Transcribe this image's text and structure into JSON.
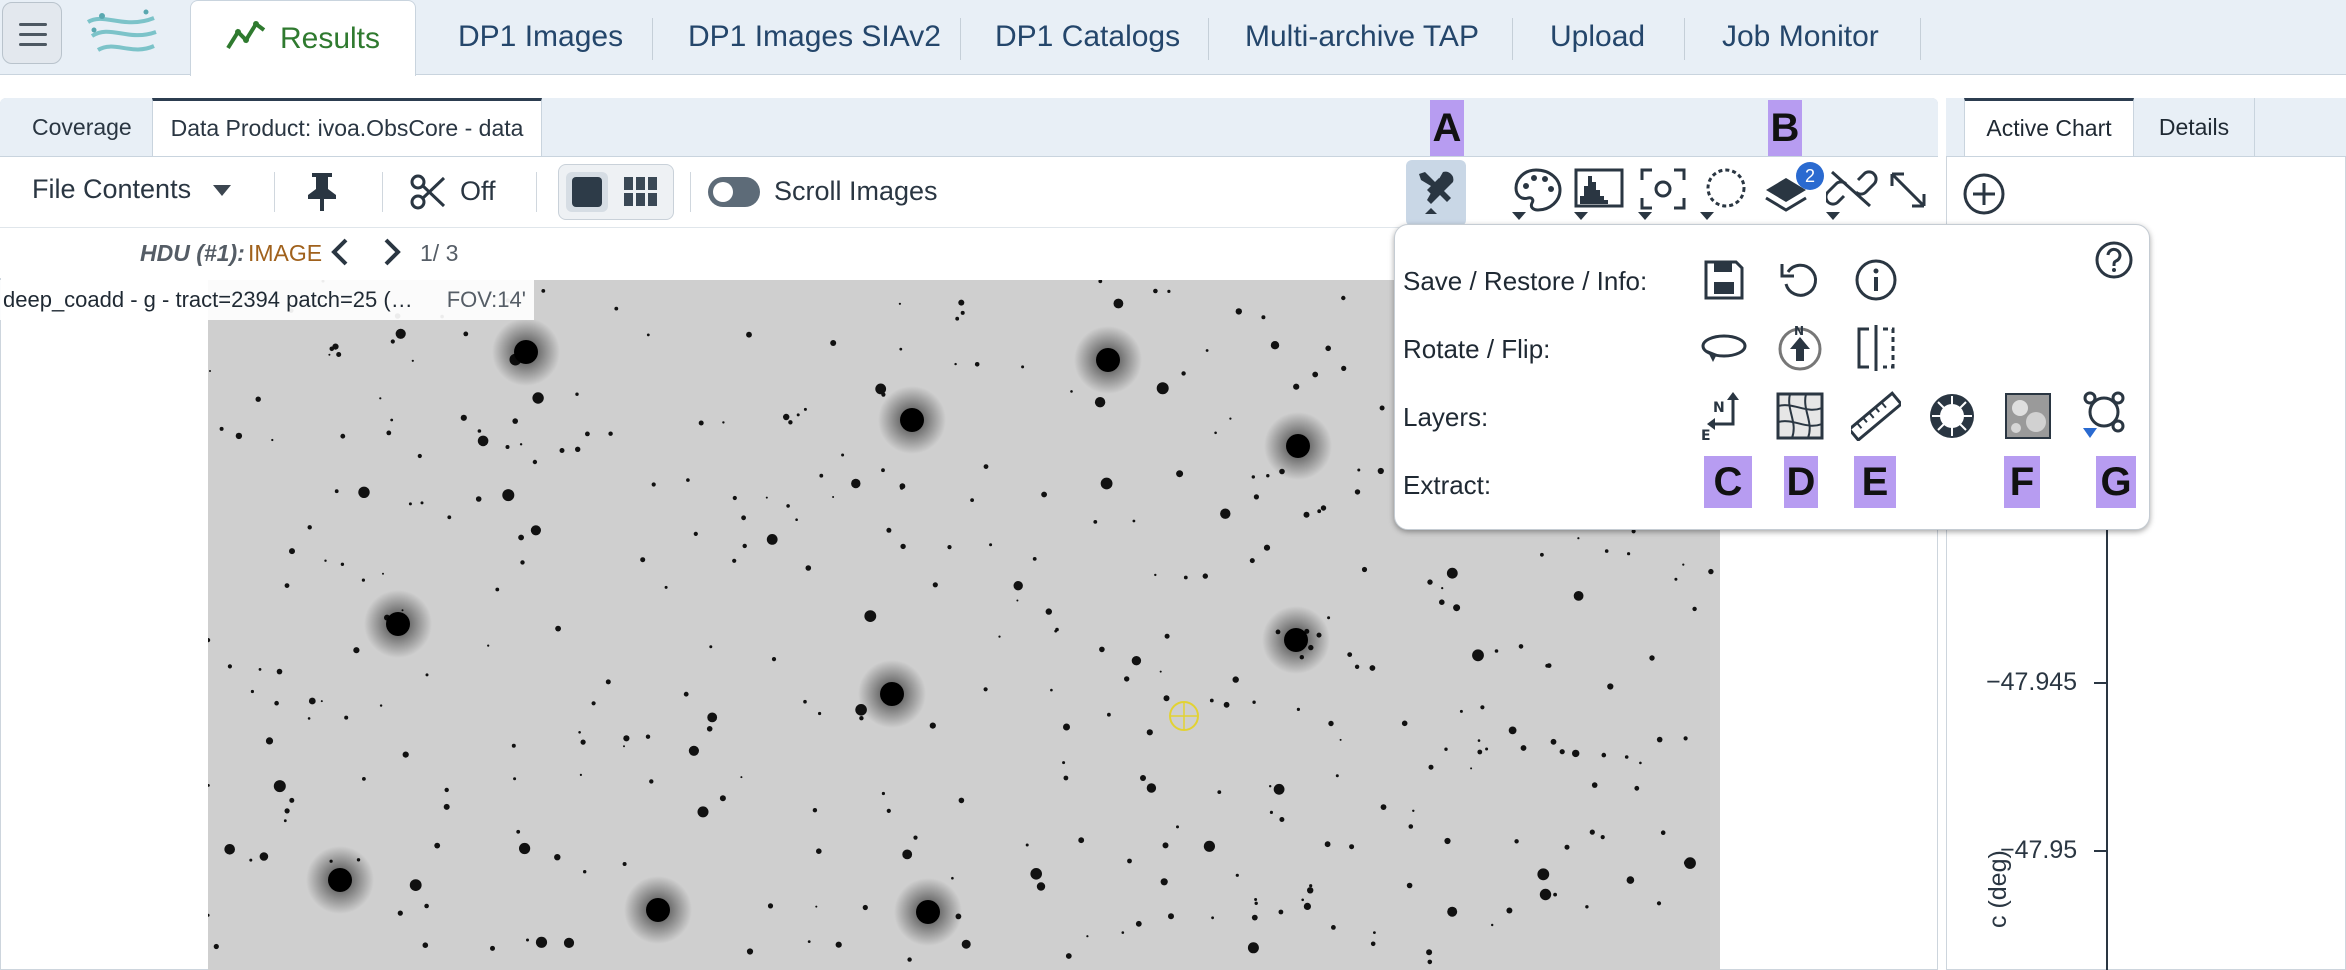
{
  "nav": {
    "tabs": [
      "Results",
      "DP1 Images",
      "DP1 Images SIAv2",
      "DP1 Catalogs",
      "Multi-archive TAP",
      "Upload",
      "Job Monitor"
    ]
  },
  "panel": {
    "tabs": [
      "Coverage",
      "Data Product: ivoa.ObsCore - data"
    ]
  },
  "toolbar": {
    "file_contents": "File Contents",
    "cut_label": "Off",
    "scroll_images": "Scroll Images",
    "layers_badge": "2"
  },
  "hdu": {
    "label": "HDU (#1):",
    "type": "IMAGE",
    "page": "1/ 3"
  },
  "image": {
    "title": "deep_coadd - g - tract=2394 patch=25 (…",
    "fov": "FOV:14'"
  },
  "right_panel": {
    "tabs": [
      "Active Chart",
      "Details"
    ],
    "y_ticks": [
      "−47.945",
      "−47.95"
    ],
    "y_axis_label": "c (deg)"
  },
  "popup": {
    "rows": [
      "Save / Restore / Info:",
      "Rotate / Flip:",
      "Layers:",
      "Extract:"
    ]
  },
  "callouts": [
    "A",
    "B",
    "C",
    "D",
    "E",
    "F",
    "G"
  ],
  "colors": {
    "accent_green": "#2f7a2f",
    "nav_blue": "#24466b",
    "callout": "#b79cf1",
    "badge": "#2a6ad0"
  }
}
